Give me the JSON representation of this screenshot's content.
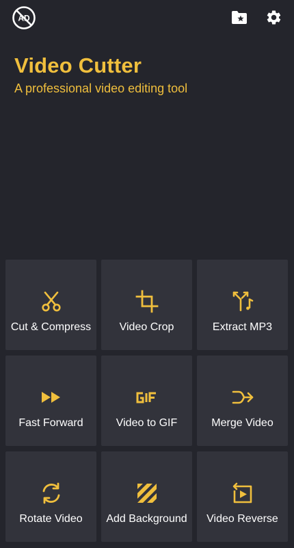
{
  "app": {
    "title": "Video Cutter",
    "subtitle": "A professional video editing tool"
  },
  "header": {
    "no_ad_label": "AD",
    "icons": [
      "no-ads-icon",
      "folder-star-icon",
      "gear-icon"
    ]
  },
  "tools": [
    {
      "label": "Cut & Compress",
      "icon": "scissors-icon"
    },
    {
      "label": "Video Crop",
      "icon": "crop-icon"
    },
    {
      "label": "Extract MP3",
      "icon": "split-music-icon"
    },
    {
      "label": "Fast Forward",
      "icon": "fast-forward-icon"
    },
    {
      "label": "Video to GIF",
      "icon": "gif-icon"
    },
    {
      "label": "Merge Video",
      "icon": "merge-icon"
    },
    {
      "label": "Rotate Video",
      "icon": "rotate-icon"
    },
    {
      "label": "Add Background",
      "icon": "stripes-icon"
    },
    {
      "label": "Video Reverse",
      "icon": "reverse-play-icon"
    }
  ],
  "colors": {
    "accent": "#f0bf3d",
    "background": "#24252c",
    "tile": "#32333b",
    "text": "#ffffff"
  }
}
